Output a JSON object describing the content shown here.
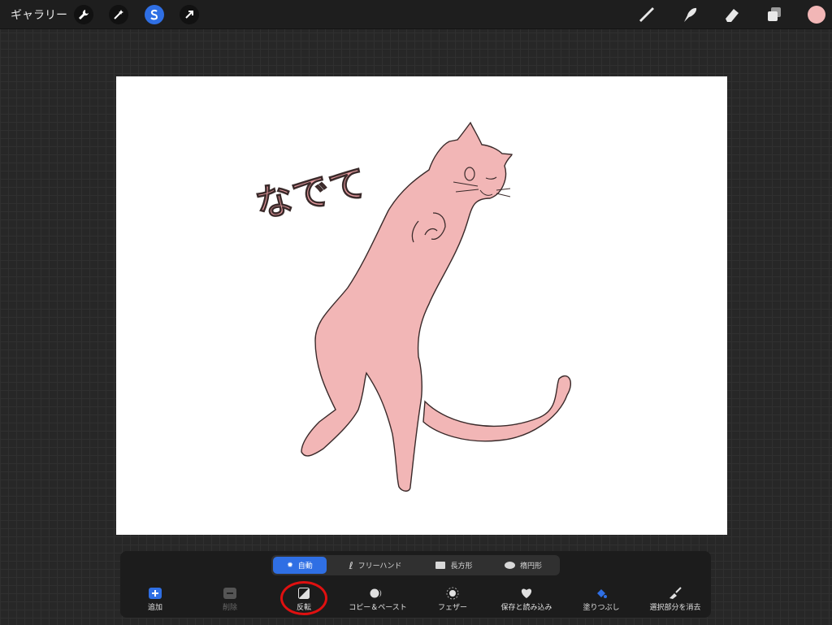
{
  "topbar": {
    "gallery_label": "ギャラリー",
    "left_tools": [
      "wrench-icon",
      "magic-wand-icon",
      "selection-icon",
      "transform-arrow-icon"
    ],
    "right_tools": [
      "brush-icon",
      "smudge-icon",
      "eraser-icon",
      "layers-icon"
    ],
    "active_tool": "selection-icon",
    "current_color": "#f2b6b6"
  },
  "canvas": {
    "text": "なでて",
    "text_color": "#e89ba0",
    "cat_fill": "#f2b6b6",
    "outline": "#3a2a2a"
  },
  "selection_panel": {
    "modes": [
      {
        "label": "自動",
        "icon": "sun-icon",
        "selected": true
      },
      {
        "label": "フリーハンド",
        "icon": "freehand-icon",
        "selected": false
      },
      {
        "label": "長方形",
        "icon": "rectangle-icon",
        "selected": false
      },
      {
        "label": "楕円形",
        "icon": "ellipse-icon",
        "selected": false
      }
    ],
    "tools": [
      {
        "label": "追加",
        "icon": "add-icon",
        "enabled": true
      },
      {
        "label": "削除",
        "icon": "remove-icon",
        "enabled": false
      },
      {
        "label": "反転",
        "icon": "invert-icon",
        "enabled": true
      },
      {
        "label": "コピー＆ペースト",
        "icon": "copy-paste-icon",
        "enabled": true
      },
      {
        "label": "フェザー",
        "icon": "feather-icon",
        "enabled": true
      },
      {
        "label": "保存と読み込み",
        "icon": "heart-icon",
        "enabled": true
      },
      {
        "label": "塗りつぶし",
        "icon": "fill-icon",
        "enabled": true
      },
      {
        "label": "選択部分を消去",
        "icon": "clear-selection-icon",
        "enabled": true
      }
    ]
  }
}
